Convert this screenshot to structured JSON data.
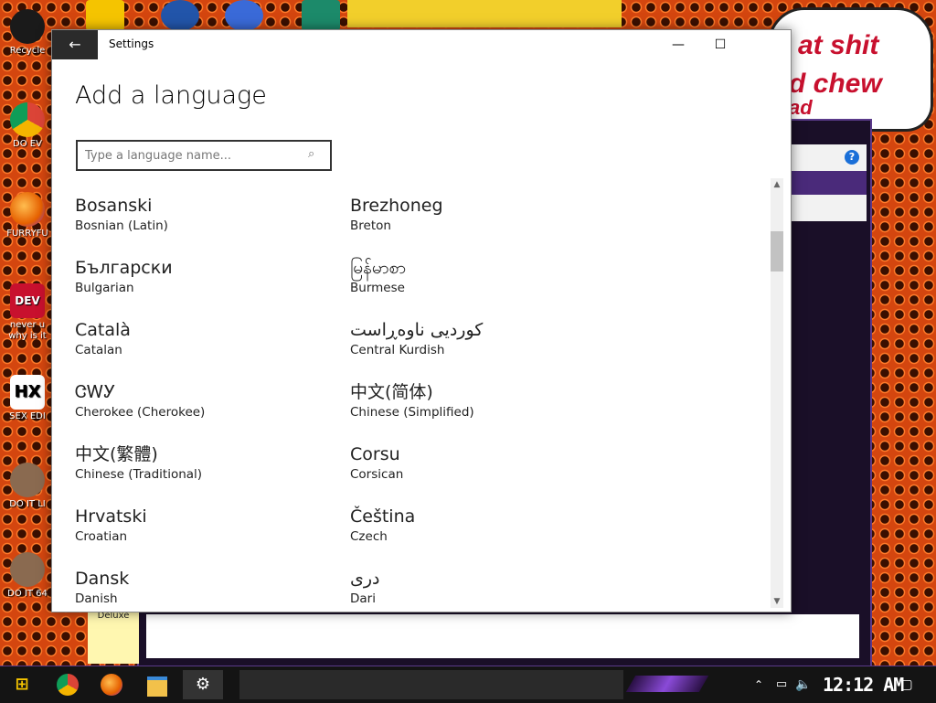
{
  "desktop": {
    "icons": [
      {
        "label": "Recycle",
        "color": "#1a1a1a"
      },
      {
        "label": "DO EV",
        "color": "#2b7de9"
      },
      {
        "label": "FURRYFU",
        "color": "#e66000"
      },
      {
        "label": "never u\nwhy is it",
        "color": "#c8102e"
      },
      {
        "label": "SEX EDI",
        "color": "#ffffff"
      },
      {
        "label": "DO IT LI",
        "color": "#8a6a50"
      },
      {
        "label": "DO IT 64",
        "color": "#8a6a50"
      }
    ],
    "speech_bubble": {
      "line1": "at shit",
      "line2": "d chew",
      "line3": "ad"
    },
    "deluxe_label": "Deluxe"
  },
  "settings": {
    "title": "Settings",
    "back_icon": "back-arrow-icon",
    "minimize": "—",
    "maximize": "☐",
    "heading": "Add a language",
    "search": {
      "placeholder": "Type a language name...",
      "value": ""
    },
    "languages": [
      {
        "native": "Bosanski",
        "english": "Bosnian (Latin)"
      },
      {
        "native": "Brezhoneg",
        "english": "Breton"
      },
      {
        "native": "Български",
        "english": "Bulgarian"
      },
      {
        "native": "မြန်မာစာ",
        "english": "Burmese"
      },
      {
        "native": "Català",
        "english": "Catalan"
      },
      {
        "native": "کوردیی ناوەڕاست",
        "english": "Central Kurdish"
      },
      {
        "native": "ᏣᎳᎩ",
        "english": "Cherokee (Cherokee)"
      },
      {
        "native": "中文(简体)",
        "english": "Chinese (Simplified)"
      },
      {
        "native": "中文(繁體)",
        "english": "Chinese (Traditional)"
      },
      {
        "native": "Corsu",
        "english": "Corsican"
      },
      {
        "native": "Hrvatski",
        "english": "Croatian"
      },
      {
        "native": "Čeština",
        "english": "Czech"
      },
      {
        "native": "Dansk",
        "english": "Danish"
      },
      {
        "native": "دری",
        "english": "Dari"
      }
    ]
  },
  "taskbar": {
    "start_icon": "start-icon",
    "clock": "12:12 AM",
    "apps": [
      "chrome-icon",
      "firefox-icon",
      "file-explorer-icon",
      "settings-gear-icon"
    ]
  }
}
